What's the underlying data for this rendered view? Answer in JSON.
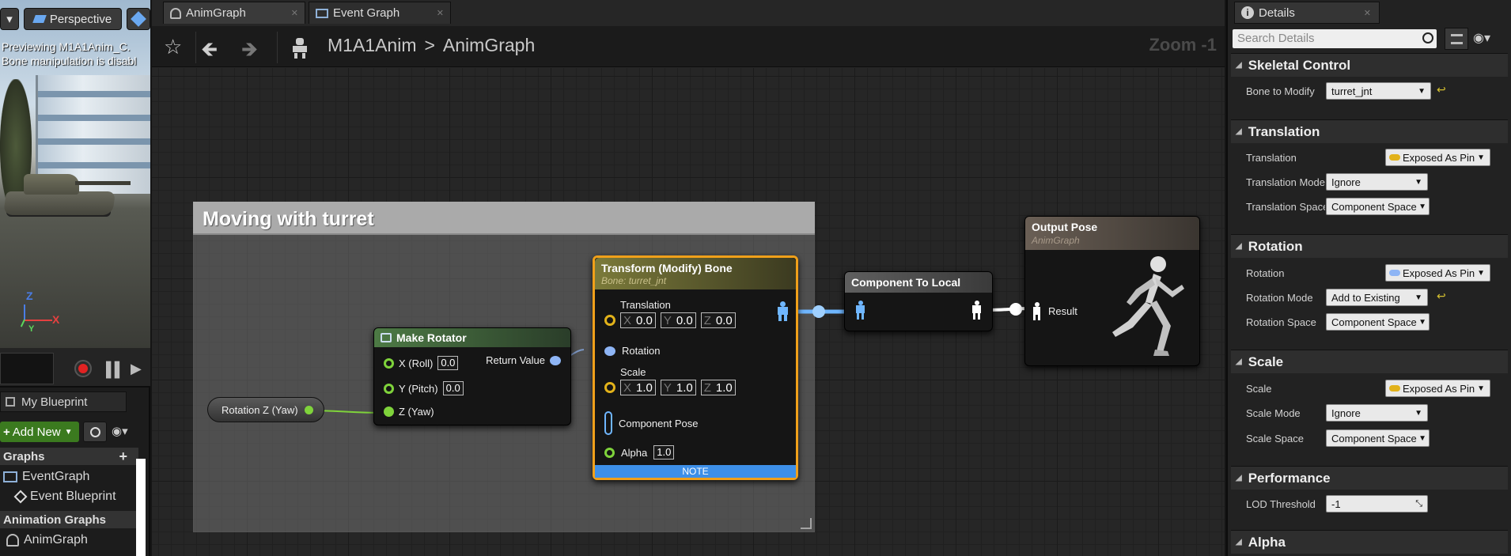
{
  "viewport": {
    "dropdown_glyph": "▾",
    "perspective_label": "Perspective",
    "message_line1": "Previewing M1A1Anim_C.",
    "message_line2": "Bone manipulation is disabl",
    "axis_z": "Z",
    "axis_x": "X",
    "axis_y": "Y"
  },
  "my_blueprint": {
    "tab_label": "My Blueprint",
    "add_new_label": "Add New",
    "graphs_section": "Graphs",
    "add_graph_glyph": "+",
    "graph_items": [
      "EventGraph",
      "Event Blueprint"
    ],
    "anim_section": "Animation Graphs",
    "anim_items": [
      "AnimGraph"
    ]
  },
  "tabs": [
    {
      "label": "AnimGraph",
      "icon": "anim-graph-icon",
      "active": true
    },
    {
      "label": "Event Graph",
      "icon": "event-graph-icon",
      "active": false
    }
  ],
  "toolbar": {
    "breadcrumb_root": "M1A1Anim",
    "breadcrumb_separator": ">",
    "breadcrumb_leaf": "AnimGraph",
    "zoom": "Zoom -1"
  },
  "graph": {
    "comment_title": "Moving with turret",
    "rotation_var": {
      "label": "Rotation Z (Yaw)"
    },
    "make_rotator": {
      "title": "Make Rotator",
      "x_label": "X (Roll)",
      "x_value": "0.0",
      "y_label": "Y (Pitch)",
      "y_value": "0.0",
      "z_label": "Z (Yaw)",
      "return_label": "Return Value"
    },
    "transform_bone": {
      "title": "Transform (Modify) Bone",
      "subtitle": "Bone: turret_jnt",
      "translation_label": "Translation",
      "translation": {
        "x": "0.0",
        "y": "0.0",
        "z": "0.0"
      },
      "rotation_label": "Rotation",
      "scale_label": "Scale",
      "scale": {
        "x": "1.0",
        "y": "1.0",
        "z": "1.0"
      },
      "axis_x": "X",
      "axis_y": "Y",
      "axis_z": "Z",
      "component_pose_label": "Component Pose",
      "alpha_label": "Alpha",
      "alpha_value": "1.0",
      "note": "NOTE"
    },
    "component_to_local": {
      "title": "Component To Local"
    },
    "output_pose": {
      "title": "Output Pose",
      "subtitle": "AnimGraph",
      "result_label": "Result"
    }
  },
  "details": {
    "tab_label": "Details",
    "search_placeholder": "Search Details",
    "sections": {
      "skeletal_control": {
        "title": "Skeletal Control",
        "bone_to_modify_label": "Bone to Modify",
        "bone_to_modify_value": "turret_jnt"
      },
      "translation": {
        "title": "Translation",
        "translation_label": "Translation",
        "translation_value": "Exposed As Pin",
        "mode_label": "Translation Mode",
        "mode_value": "Ignore",
        "space_label": "Translation Space",
        "space_value": "Component Space"
      },
      "rotation": {
        "title": "Rotation",
        "rotation_label": "Rotation",
        "rotation_value": "Exposed As Pin",
        "mode_label": "Rotation Mode",
        "mode_value": "Add to Existing",
        "space_label": "Rotation Space",
        "space_value": "Component Space"
      },
      "scale": {
        "title": "Scale",
        "scale_label": "Scale",
        "scale_value": "Exposed As Pin",
        "mode_label": "Scale Mode",
        "mode_value": "Ignore",
        "space_label": "Scale Space",
        "space_value": "Component Space"
      },
      "performance": {
        "title": "Performance",
        "lod_label": "LOD Threshold",
        "lod_value": "-1"
      },
      "alpha": {
        "title": "Alpha"
      }
    }
  },
  "colors": {
    "exec_green": "#7fd33b",
    "struct_blue": "#8eb5f5",
    "vector_gold": "#e2b21a",
    "pose_blue": "#6fb6ff",
    "node_selected": "#f0a01a",
    "note_bar": "#3d8fe8",
    "add_new_green": "#3b7a1f"
  }
}
